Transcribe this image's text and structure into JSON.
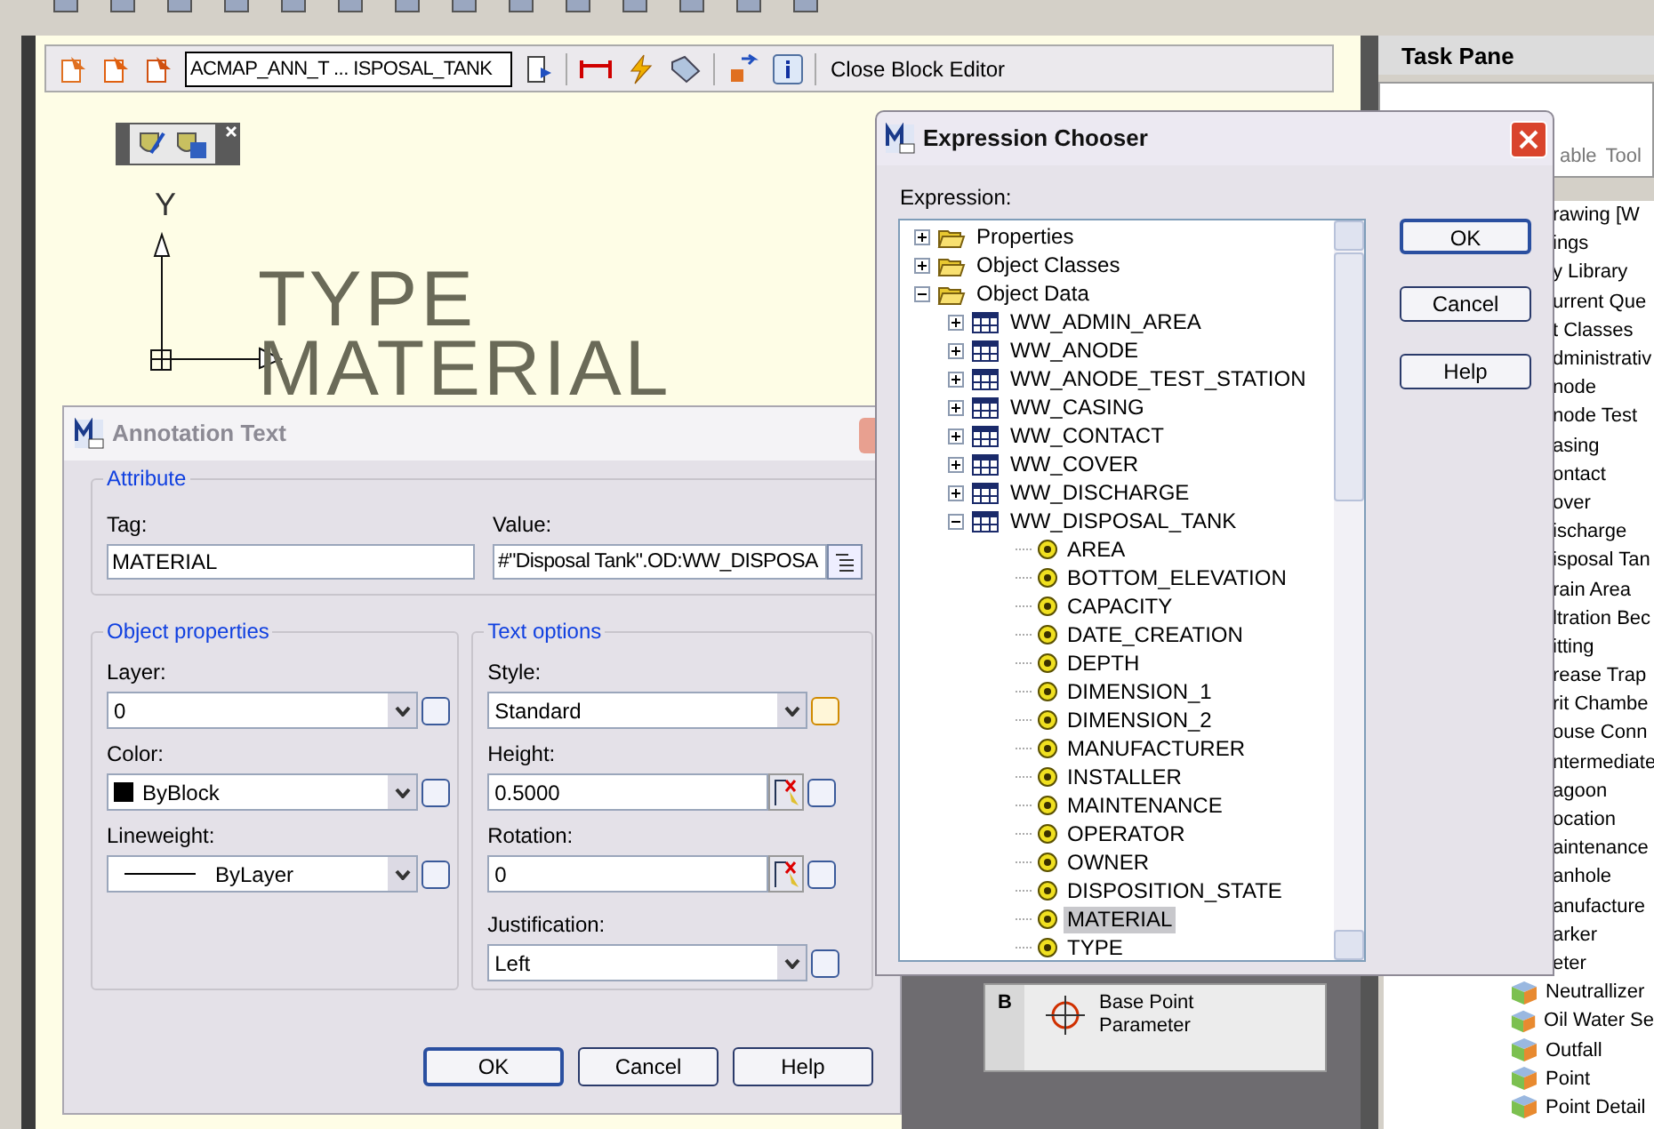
{
  "block_editor_toolbar": {
    "block_name": "ACMAP_ANN_T ... ISPOSAL_TANK",
    "close_label": "Close Block Editor"
  },
  "drawing": {
    "axis_label": "Y",
    "texts": [
      "TYPE",
      "MATERIAL"
    ]
  },
  "annotation_dialog": {
    "title": "Annotation Text",
    "attribute": {
      "title": "Attribute",
      "tag_label": "Tag:",
      "tag_value": "MATERIAL",
      "value_label": "Value:",
      "value": "#\"Disposal Tank\".OD:WW_DISPOSA"
    },
    "groups": [
      {
        "title": "Object properties",
        "fields": [
          {
            "label": "Layer:",
            "value": "0",
            "kind": "combo"
          },
          {
            "label": "Color:",
            "value": "ByBlock",
            "kind": "swatch"
          },
          {
            "label": "Lineweight:",
            "value": "ByLayer",
            "kind": "line"
          }
        ]
      },
      {
        "title": "Text options",
        "fields": [
          {
            "label": "Style:",
            "value": "Standard",
            "kind": "style"
          },
          {
            "label": "Height:",
            "value": "0.5000",
            "kind": "pick"
          },
          {
            "label": "Rotation:",
            "value": "0",
            "kind": "pick"
          },
          {
            "label": "Justification:",
            "value": "Left",
            "kind": "combo"
          }
        ]
      }
    ],
    "buttons": [
      "OK",
      "Cancel",
      "Help"
    ]
  },
  "expression_chooser": {
    "title": "Expression Chooser",
    "label": "Expression:",
    "tree": [
      {
        "label": "Properties",
        "kind": "folder",
        "expanded": false,
        "selected": false
      },
      {
        "label": "Object Classes",
        "kind": "folder",
        "expanded": false,
        "selected": false
      },
      {
        "label": "Object Data",
        "kind": "folder",
        "expanded": true,
        "selected": false,
        "children": [
          {
            "label": "WW_ADMIN_AREA",
            "kind": "table",
            "expanded": false,
            "selected": false
          },
          {
            "label": "WW_ANODE",
            "kind": "table",
            "expanded": false,
            "selected": false
          },
          {
            "label": "WW_ANODE_TEST_STATION",
            "kind": "table",
            "expanded": false,
            "selected": false
          },
          {
            "label": "WW_CASING",
            "kind": "table",
            "expanded": false,
            "selected": false
          },
          {
            "label": "WW_CONTACT",
            "kind": "table",
            "expanded": false,
            "selected": false
          },
          {
            "label": "WW_COVER",
            "kind": "table",
            "expanded": false,
            "selected": false
          },
          {
            "label": "WW_DISCHARGE",
            "kind": "table",
            "expanded": false,
            "selected": false
          },
          {
            "label": "WW_DISPOSAL_TANK",
            "kind": "table",
            "expanded": true,
            "selected": false,
            "children": [
              {
                "label": "AREA",
                "kind": "field",
                "selected": false
              },
              {
                "label": "BOTTOM_ELEVATION",
                "kind": "field",
                "selected": false
              },
              {
                "label": "CAPACITY",
                "kind": "field",
                "selected": false
              },
              {
                "label": "DATE_CREATION",
                "kind": "field",
                "selected": false
              },
              {
                "label": "DEPTH",
                "kind": "field",
                "selected": false
              },
              {
                "label": "DIMENSION_1",
                "kind": "field",
                "selected": false
              },
              {
                "label": "DIMENSION_2",
                "kind": "field",
                "selected": false
              },
              {
                "label": "MANUFACTURER",
                "kind": "field",
                "selected": false
              },
              {
                "label": "INSTALLER",
                "kind": "field",
                "selected": false
              },
              {
                "label": "MAINTENANCE",
                "kind": "field",
                "selected": false
              },
              {
                "label": "OPERATOR",
                "kind": "field",
                "selected": false
              },
              {
                "label": "OWNER",
                "kind": "field",
                "selected": false
              },
              {
                "label": "DISPOSITION_STATE",
                "kind": "field",
                "selected": false
              },
              {
                "label": "MATERIAL",
                "kind": "field",
                "selected": true
              },
              {
                "label": "TYPE",
                "kind": "field",
                "selected": false
              }
            ]
          }
        ]
      }
    ],
    "buttons": [
      "OK",
      "Cancel",
      "Help"
    ]
  },
  "task_pane": {
    "title": "Task Pane",
    "tabs": [
      "able",
      "Tool"
    ],
    "items": [
      {
        "label": "rawing [W",
        "kind": "plain"
      },
      {
        "label": "ings",
        "kind": "plain"
      },
      {
        "label": "y Library",
        "kind": "plain"
      },
      {
        "label": "urrent Que",
        "kind": "plain"
      },
      {
        "label": "t Classes",
        "kind": "plain"
      },
      {
        "label": "dministrativ",
        "kind": "plain"
      },
      {
        "label": "node",
        "kind": "plain"
      },
      {
        "label": "node Test",
        "kind": "plain"
      },
      {
        "label": "asing",
        "kind": "plain"
      },
      {
        "label": "ontact",
        "kind": "plain"
      },
      {
        "label": "over",
        "kind": "plain"
      },
      {
        "label": "ischarge",
        "kind": "plain"
      },
      {
        "label": "isposal Tan",
        "kind": "plain"
      },
      {
        "label": "rain Area",
        "kind": "plain"
      },
      {
        "label": "ltration Bec",
        "kind": "plain"
      },
      {
        "label": "itting",
        "kind": "plain"
      },
      {
        "label": "rease Trap",
        "kind": "plain"
      },
      {
        "label": "rit Chambe",
        "kind": "plain"
      },
      {
        "label": "ouse Conn",
        "kind": "plain"
      },
      {
        "label": "ntermediate",
        "kind": "plain"
      },
      {
        "label": "agoon",
        "kind": "plain"
      },
      {
        "label": "ocation",
        "kind": "plain"
      },
      {
        "label": "aintenance",
        "kind": "plain"
      },
      {
        "label": "anhole",
        "kind": "plain"
      },
      {
        "label": "anufacture",
        "kind": "plain"
      },
      {
        "label": "arker",
        "kind": "plain"
      },
      {
        "label": "eter",
        "kind": "plain"
      },
      {
        "label": "Neutrallizer",
        "kind": "class"
      },
      {
        "label": "Oil Water Se",
        "kind": "class"
      },
      {
        "label": "Outfall",
        "kind": "class"
      },
      {
        "label": "Point",
        "kind": "class"
      },
      {
        "label": "Point Detail",
        "kind": "class"
      }
    ]
  },
  "block_panel": {
    "tab": "B",
    "label": "Base Point Parameter"
  }
}
